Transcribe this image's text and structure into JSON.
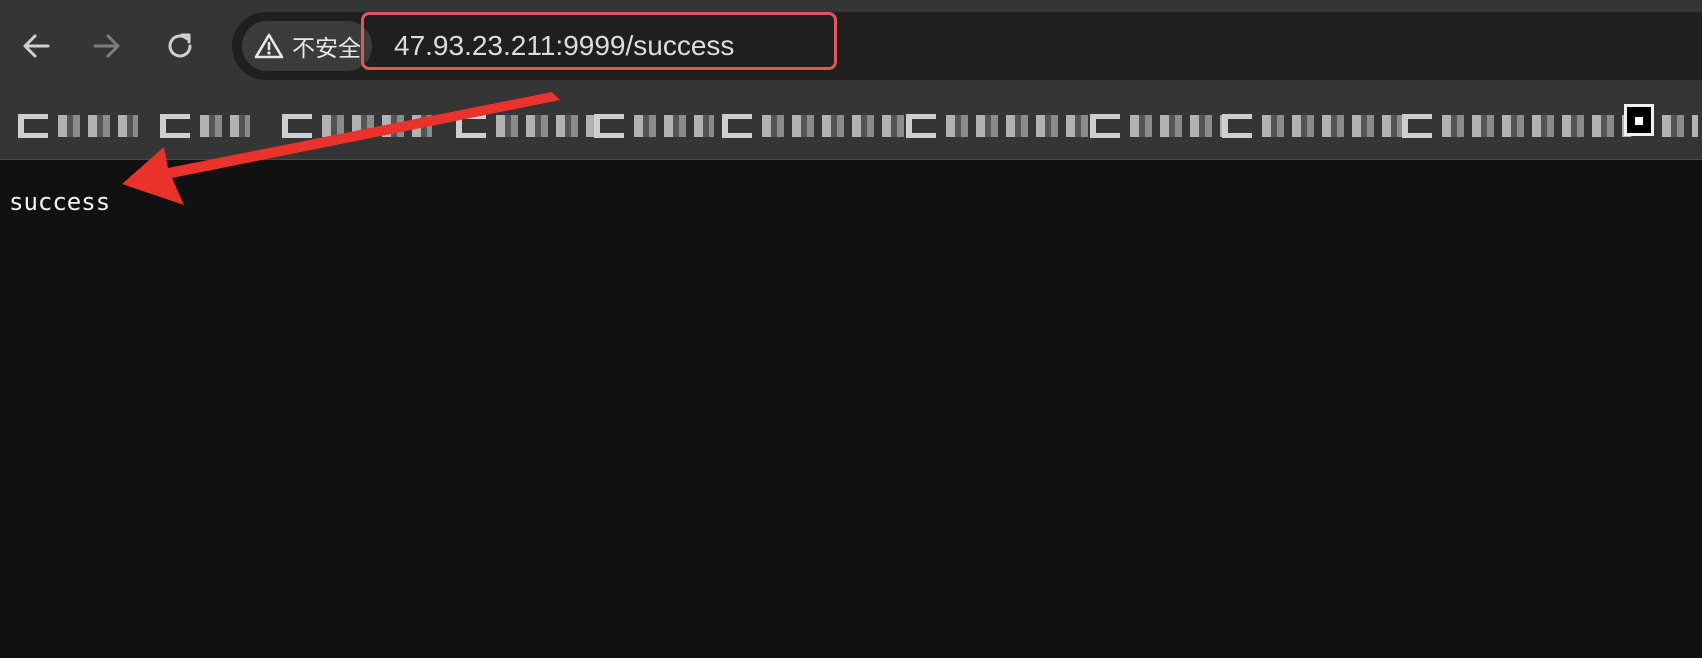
{
  "browser": {
    "nav": {
      "back": "back-arrow-icon",
      "forward": "forward-arrow-icon",
      "reload": "reload-icon"
    },
    "security_label": "不安全",
    "url": "47.93.23.211:9999/success"
  },
  "page": {
    "body_text": "success"
  },
  "annotation": {
    "highlight_color": "#e0555f",
    "arrow_color": "#e8322b"
  },
  "colors": {
    "toolbar": "#353535",
    "page_background": "#111111"
  }
}
